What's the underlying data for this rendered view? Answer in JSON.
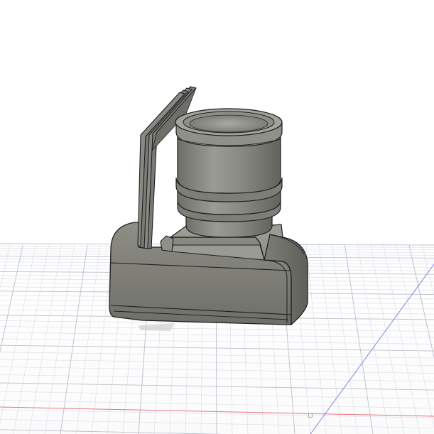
{
  "viewport": {
    "background_color": "#ffffff",
    "grid_minor_color": "#d7dce3",
    "grid_major_color": "#b9c0ca",
    "axis_x_color": "#e8747c",
    "axis_y_color": "#7f86e6"
  },
  "model": {
    "body_color": "#85857e",
    "edge_color": "#1e1e1e",
    "lens_color": "#8b8c85"
  }
}
